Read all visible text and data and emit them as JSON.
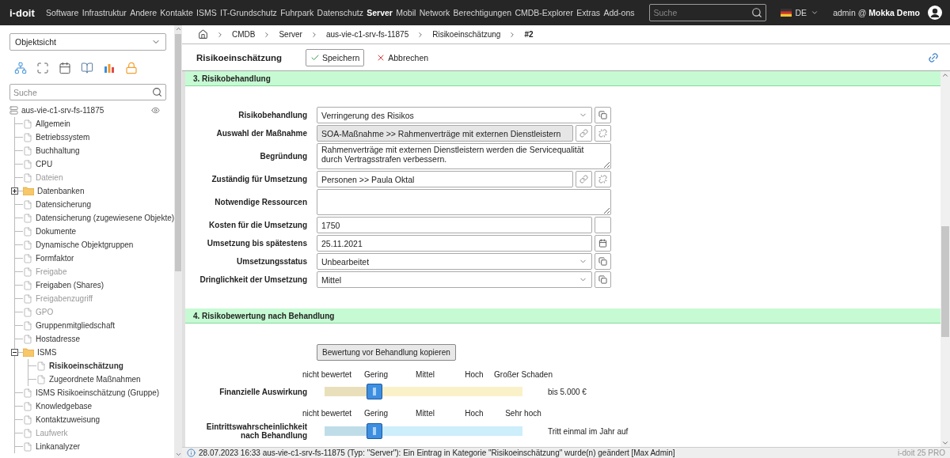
{
  "topbar": {
    "logo": "i-doit",
    "nav": [
      {
        "label": "Software",
        "selected": false
      },
      {
        "label": "Infrastruktur",
        "selected": false
      },
      {
        "label": "Andere",
        "selected": false
      },
      {
        "label": "Kontakte",
        "selected": false
      },
      {
        "label": "ISMS",
        "selected": false
      },
      {
        "label": "IT-Grundschutz",
        "selected": false
      },
      {
        "label": "Fuhrpark",
        "selected": false
      },
      {
        "label": "Datenschutz",
        "selected": false
      },
      {
        "label": "Server",
        "selected": true
      },
      {
        "label": "Mobil",
        "selected": false
      },
      {
        "label": "Network",
        "selected": false
      },
      {
        "label": "Berechtigungen",
        "selected": false
      },
      {
        "label": "CMDB-Explorer",
        "selected": false
      },
      {
        "label": "Extras",
        "selected": false
      },
      {
        "label": "Add-ons",
        "selected": false
      }
    ],
    "search": {
      "placeholder": "Suche"
    },
    "language": "DE",
    "user": "admin @ **Mokka Demo**"
  },
  "sidebar": {
    "view_select": "Objektsicht",
    "search": {
      "placeholder": "Suche"
    },
    "tree": {
      "label": "aus-vie-c1-srv-fs-11875",
      "children": [
        {
          "label": "Allgemein",
          "kind": "file",
          "disabled": false,
          "selected": false
        },
        {
          "label": "Betriebssystem",
          "kind": "file",
          "disabled": false,
          "selected": false
        },
        {
          "label": "Buchhaltung",
          "kind": "file",
          "disabled": false,
          "selected": false
        },
        {
          "label": "CPU",
          "kind": "file",
          "disabled": false,
          "selected": false
        },
        {
          "label": "Dateien",
          "kind": "file",
          "disabled": true,
          "selected": false
        },
        {
          "label": "Datenbanken",
          "kind": "folder",
          "disabled": false,
          "selected": false,
          "expanded": false
        },
        {
          "label": "Datensicherung",
          "kind": "file",
          "disabled": false,
          "selected": false
        },
        {
          "label": "Datensicherung (zugewiesene Objekte)",
          "kind": "file",
          "disabled": false,
          "selected": false
        },
        {
          "label": "Dokumente",
          "kind": "file",
          "disabled": false,
          "selected": false
        },
        {
          "label": "Dynamische Objektgruppen",
          "kind": "file",
          "disabled": false,
          "selected": false
        },
        {
          "label": "Formfaktor",
          "kind": "file",
          "disabled": false,
          "selected": false
        },
        {
          "label": "Freigabe",
          "kind": "file",
          "disabled": true,
          "selected": false
        },
        {
          "label": "Freigaben (Shares)",
          "kind": "file",
          "disabled": false,
          "selected": false
        },
        {
          "label": "Freigabenzugriff",
          "kind": "file",
          "disabled": true,
          "selected": false
        },
        {
          "label": "GPO",
          "kind": "file",
          "disabled": true,
          "selected": false
        },
        {
          "label": "Gruppenmitgliedschaft",
          "kind": "file",
          "disabled": false,
          "selected": false
        },
        {
          "label": "Hostadresse",
          "kind": "file",
          "disabled": false,
          "selected": false
        },
        {
          "label": "ISMS",
          "kind": "folder",
          "disabled": false,
          "selected": false,
          "expanded": true,
          "children": [
            {
              "label": "Risikoeinschätzung",
              "kind": "file",
              "disabled": false,
              "selected": true
            },
            {
              "label": "Zugeordnete Maßnahmen",
              "kind": "file",
              "disabled": false,
              "selected": false
            }
          ]
        },
        {
          "label": "ISMS Risikoeinschätzung (Gruppe)",
          "kind": "file",
          "disabled": false,
          "selected": false
        },
        {
          "label": "Knowledgebase",
          "kind": "file",
          "disabled": false,
          "selected": false
        },
        {
          "label": "Kontaktzuweisung",
          "kind": "file",
          "disabled": false,
          "selected": false
        },
        {
          "label": "Laufwerk",
          "kind": "file",
          "disabled": true,
          "selected": false
        },
        {
          "label": "Linkanalyzer",
          "kind": "file",
          "disabled": false,
          "selected": false
        }
      ]
    }
  },
  "main": {
    "breadcrumb": [
      {
        "label": "CMDB",
        "current": false
      },
      {
        "label": "Server",
        "current": false
      },
      {
        "label": "aus-vie-c1-srv-fs-11875",
        "current": false
      },
      {
        "label": "Risikoeinschätzung",
        "current": false
      },
      {
        "label": "#2",
        "current": true
      }
    ],
    "title": "Risikoeinschätzung",
    "actions": [
      {
        "kind": "save",
        "label": "Speichern"
      },
      {
        "kind": "cancel",
        "label": "Abbrechen"
      }
    ],
    "sections": [
      {
        "title": "3. Risikobehandlung",
        "fields": [
          {
            "label": "Risikobehandlung",
            "kind": "select",
            "value": "Verringerung des Risikos",
            "disabled": false
          },
          {
            "label": "Auswahl der Maßnahme",
            "kind": "link",
            "value": "SOA-Maßnahme >> Rahmenverträge mit externen Dienstleistern",
            "disabled": true
          },
          {
            "label": "Begründung",
            "kind": "textarea",
            "value": "Rahmenverträge mit externen Dienstleistern werden die Servicequalität durch Vertragsstrafen verbessern.",
            "disabled": false
          },
          {
            "label": "Zuständig für Umsetzung",
            "kind": "link",
            "value": "Personen >> Paula Oktal",
            "disabled": false
          },
          {
            "label": "Notwendige Ressourcen",
            "kind": "textarea",
            "disabled": false
          },
          {
            "label": "Kosten für die Umsetzung",
            "kind": "text",
            "value": "1750",
            "disabled": false
          },
          {
            "label": "Umsetzung bis spätestens",
            "kind": "date",
            "value": "25.11.2021",
            "disabled": false
          },
          {
            "label": "Umsetzungsstatus",
            "kind": "select",
            "value": "Unbearbeitet",
            "disabled": false
          },
          {
            "label": "Dringlichkeit der Umsetzung",
            "kind": "select",
            "value": "Mittel",
            "disabled": false
          }
        ]
      },
      {
        "title": "4. Risikobewertung nach Behandlung",
        "copy_button": "Bewertung vor Behandlung kopieren",
        "sliders": [
          {
            "label": "Finanzielle Auswirkung",
            "scale": [
              "nicht bewertet",
              "Gering",
              "Mittel",
              "Hoch",
              "Großer Schaden"
            ],
            "level": 0.25,
            "color": "#fbf1c9",
            "reading": "bis 5.000 €"
          },
          {
            "label": "Eintrittswahrscheinlichkeit nach Behandlung",
            "scale": [
              "nicht bewertet",
              "Gering",
              "Mittel",
              "Hoch",
              "Sehr hoch"
            ],
            "level": 0.25,
            "color": "#cdeefb",
            "reading": "Tritt einmal im Jahr auf"
          }
        ]
      }
    ]
  },
  "status_bar": {
    "message": "28.07.2023 16:33 aus-vie-c1-srv-fs-11875 (Typ: \"Server\"): Ein Eintrag in Kategorie \"Risikoeinschätzung\" wurde(n) geändert [Max Admin]",
    "version": "i-doit 25 PRO"
  }
}
